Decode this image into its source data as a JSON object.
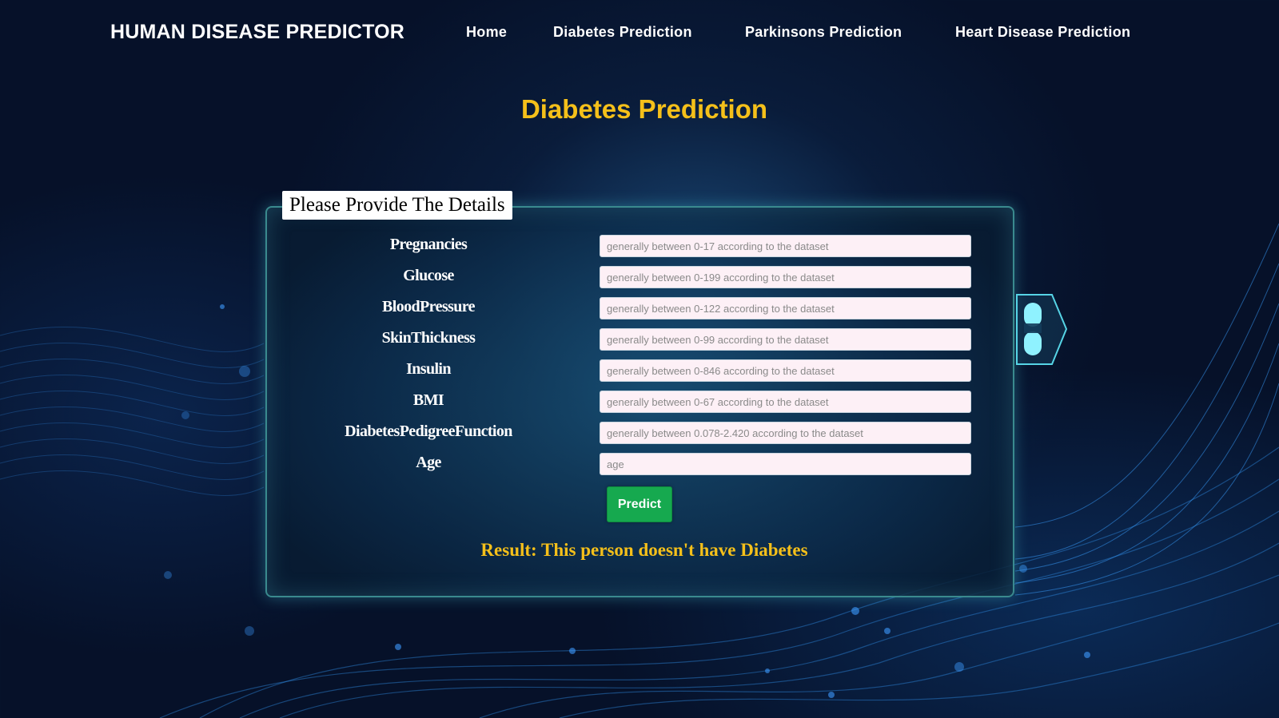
{
  "nav": {
    "brand": "HUMAN DISEASE PREDICTOR",
    "links": [
      {
        "label": "Home"
      },
      {
        "label": "Diabetes Prediction"
      },
      {
        "label": "Parkinsons Prediction"
      },
      {
        "label": "Heart Disease Prediction"
      }
    ]
  },
  "page": {
    "title": "Diabetes Prediction"
  },
  "form": {
    "legend": "Please Provide The Details",
    "fields": [
      {
        "label": "Pregnancies",
        "value": "",
        "placeholder": "generally between 0-17 according to the dataset"
      },
      {
        "label": "Glucose",
        "value": "",
        "placeholder": "generally between 0-199 according to the dataset"
      },
      {
        "label": "BloodPressure",
        "value": "",
        "placeholder": "generally between 0-122 according to the dataset"
      },
      {
        "label": "SkinThickness",
        "value": "",
        "placeholder": "generally between 0-99 according to the dataset"
      },
      {
        "label": "Insulin",
        "value": "",
        "placeholder": "generally between 0-846 according to the dataset"
      },
      {
        "label": "BMI",
        "value": "",
        "placeholder": "generally between 0-67 according to the dataset"
      },
      {
        "label": "DiabetesPedigreeFunction",
        "value": "",
        "placeholder": "generally between 0.078-2.420 according to the dataset"
      },
      {
        "label": "Age",
        "value": "",
        "placeholder": "age"
      }
    ],
    "submit_label": "Predict",
    "result": "Result: This person doesn't have Diabetes"
  },
  "decor": {
    "pill_icon": "capsule-icon"
  },
  "colors": {
    "accent": "#f5c01a",
    "button": "#16a94f",
    "background": "#061129",
    "panel_border": "#3a8a8e",
    "input_bg": "#fdf0f6"
  }
}
